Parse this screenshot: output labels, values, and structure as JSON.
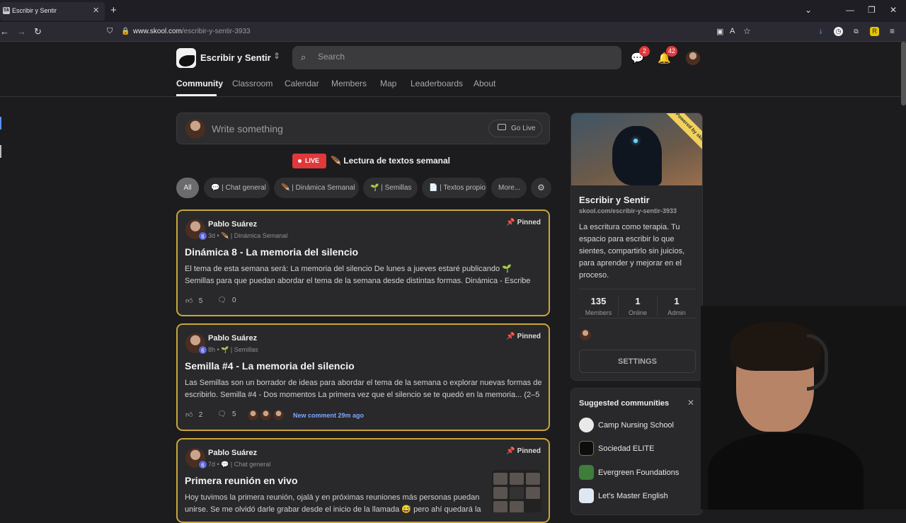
{
  "browser": {
    "tab_title": "Escribir y Sentir",
    "favicon_text": "Sk",
    "url_domain": "www.skool.com",
    "url_path": "/escribir-y-sentir-3933"
  },
  "header": {
    "community_name": "Escribir y Sentir",
    "search_placeholder": "Search",
    "chat_badge": "2",
    "notif_badge": "42"
  },
  "nav": {
    "tabs": [
      "Community",
      "Classroom",
      "Calendar",
      "Members",
      "Map",
      "Leaderboards",
      "About"
    ],
    "active": "Community"
  },
  "composer": {
    "placeholder": "Write something",
    "go_live": "Go Live"
  },
  "live_banner": {
    "badge": "LIVE",
    "title": "Lectura de textos semanal"
  },
  "filters": [
    "All",
    "💬 | Chat general",
    "🪶 | Dinámica Semanal",
    "🌱 | Semillas",
    "📄 | Textos propio",
    "More..."
  ],
  "posts": [
    {
      "author": "Pablo Suárez",
      "level": "6",
      "meta": "3d • 🪶 | Dinámica Semanal",
      "pinned": "Pinned",
      "title": "Dinámica 8 - La memoria del silencio",
      "body": "El tema de esta semana será: La memoria del silencio De lunes a jueves estaré publicando 🌱 Semillas para que puedan abordar el tema de la semana desde distintas formas. Dinámica - Escribe sobre el",
      "likes": "5",
      "comments": "0"
    },
    {
      "author": "Pablo Suárez",
      "level": "6",
      "meta": "8h • 🌱 | Semillas",
      "pinned": "Pinned",
      "title": "Semilla #4 - La memoria del silencio",
      "body": "Las Semillas son un borrador de ideas para abordar el tema de la semana o explorar nuevas formas de escribirlo. Semilla #4 - Dos momentos La primera vez que el silencio se te quedó en la memoria... (2–5",
      "likes": "2",
      "comments": "5",
      "new_comment": "New comment 29m ago"
    },
    {
      "author": "Pablo Suárez",
      "level": "6",
      "meta": "7d • 💬 | Chat general",
      "pinned": "Pinned",
      "title": "Primera reunión en vivo",
      "body": "Hoy tuvimos la primera reunión, ojalá y en próximas reuniones más personas puedan unirse. Se me olvidó darle grabar desde el inicio de la llamada 😅 pero ahí quedará la"
    }
  ],
  "community_card": {
    "ribbon": "Powered by skool",
    "name": "Escribir y Sentir",
    "url": "skool.com/escribir-y-sentir-3933",
    "description": "La escritura como terapia. Tu espacio para escribir lo que sientes, compartirlo sin juicios, para aprender y mejorar en el proceso.",
    "stats": [
      {
        "value": "135",
        "label": "Members"
      },
      {
        "value": "1",
        "label": "Online"
      },
      {
        "value": "1",
        "label": "Admin"
      }
    ],
    "settings_label": "SETTINGS"
  },
  "suggested": {
    "title": "Suggested communities",
    "items": [
      "Camp Nursing School",
      "Sociedad ELITE",
      "Evergreen Foundations",
      "Let's Master English"
    ]
  },
  "colors": {
    "pinned_border": "#c9a53a",
    "live_red": "#e0383b",
    "level_badge": "#5b63d3",
    "link_blue": "#7ea7ff"
  }
}
